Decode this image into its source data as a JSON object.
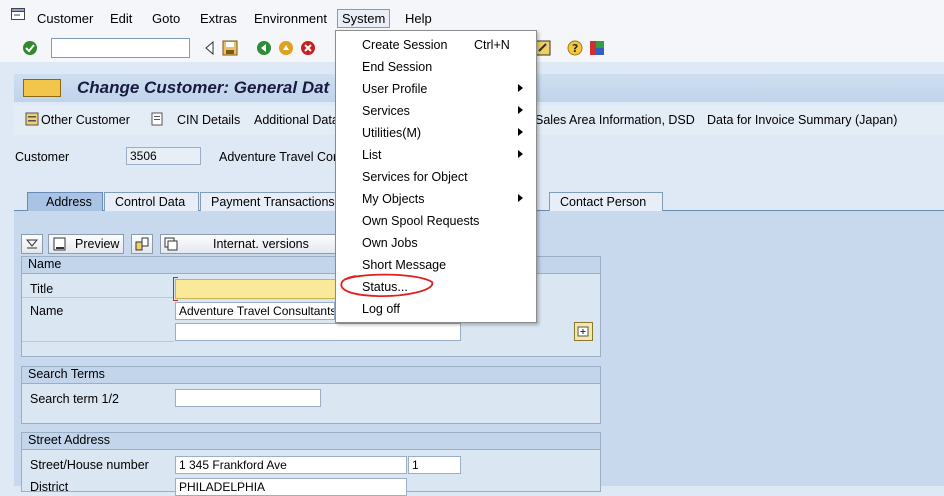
{
  "menubar": {
    "items": [
      "Customer",
      "Edit",
      "Goto",
      "Extras",
      "Environment",
      "System",
      "Help"
    ]
  },
  "title": "Change Customer: General Dat",
  "app_toolbar": {
    "other_customer": "Other Customer",
    "cin_details": "CIN Details",
    "additional_data": "Additional Data",
    "sales_area_info": "Sales Area Information, DSD",
    "invoice_summary": "Data for Invoice Summary (Japan)"
  },
  "header": {
    "customer_label": "Customer",
    "customer_value": "3506",
    "customer_name": "Adventure Travel Con"
  },
  "tabs": [
    "Address",
    "Control Data",
    "Payment Transactions",
    "Contact Person"
  ],
  "address_toolbar": {
    "preview": "Preview",
    "internat_versions": "Internat. versions"
  },
  "name_group": {
    "header": "Name",
    "title_label": "Title",
    "title_value": "",
    "name_label": "Name",
    "name_value": "Adventure Travel Consultants",
    "name2_value": ""
  },
  "search_group": {
    "header": "Search Terms",
    "term_label": "Search term 1/2",
    "term_value": ""
  },
  "street_group": {
    "header": "Street Address",
    "street_label": "Street/House number",
    "street_value": "1 345 Frankford Ave",
    "house_value": "1",
    "district_label": "District",
    "district_value": "PHILADELPHIA"
  },
  "system_menu": {
    "items": [
      {
        "label": "Create Session",
        "shortcut": "Ctrl+N",
        "submenu": false
      },
      {
        "label": "End Session",
        "shortcut": "",
        "submenu": false
      },
      {
        "label": "User Profile",
        "shortcut": "",
        "submenu": true
      },
      {
        "label": "Services",
        "shortcut": "",
        "submenu": true
      },
      {
        "label": "Utilities(M)",
        "shortcut": "",
        "submenu": true
      },
      {
        "label": "List",
        "shortcut": "",
        "submenu": true
      },
      {
        "label": "Services for Object",
        "shortcut": "",
        "submenu": false
      },
      {
        "label": "My Objects",
        "shortcut": "",
        "submenu": true
      },
      {
        "label": "Own Spool Requests",
        "shortcut": "",
        "submenu": false
      },
      {
        "label": "Own Jobs",
        "shortcut": "",
        "submenu": false
      },
      {
        "label": "Short Message",
        "shortcut": "",
        "submenu": false
      },
      {
        "label": "Status...",
        "shortcut": "",
        "submenu": false
      },
      {
        "label": "Log off",
        "shortcut": "",
        "submenu": false
      }
    ]
  },
  "colors": {
    "annotation_circle": "#e0201c",
    "required_field": "#fbe99a"
  },
  "icons": [
    "sap-window-icon",
    "enter-check-icon",
    "back-triangle-icon",
    "save-icon",
    "back-icon",
    "exit-icon",
    "cancel-icon",
    "help-icon",
    "layout-icon",
    "expand-icon",
    "preview-icon",
    "detail-icon",
    "multiple-selection-icon"
  ]
}
